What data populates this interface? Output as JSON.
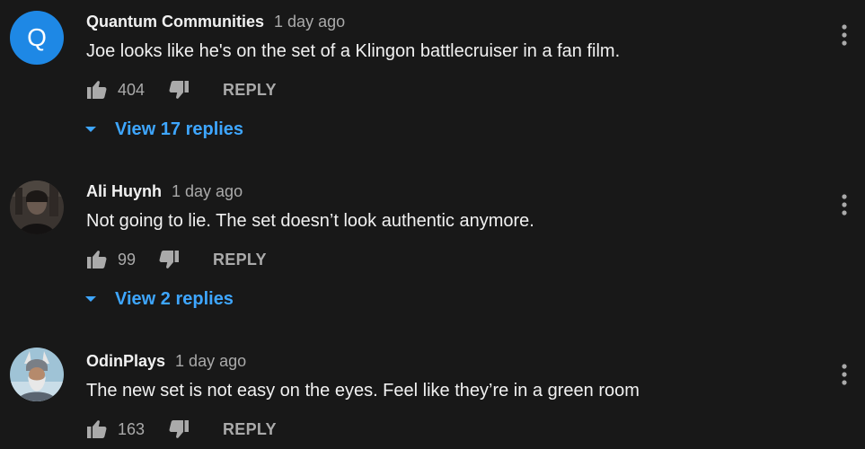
{
  "comments": [
    {
      "author": "Quantum Communities",
      "time": "1 day ago",
      "text": "Joe looks like he's on the set of a Klingon battlecruiser in a fan film.",
      "avatar_letter": "Q",
      "avatar_color": "#1e88e5",
      "likes": "404",
      "reply_label": "REPLY",
      "view_replies": "View 17 replies"
    },
    {
      "author": "Ali Huynh",
      "time": "1 day ago",
      "text": "Not going to lie. The set doesn’t look authentic anymore.",
      "likes": "99",
      "reply_label": "REPLY",
      "view_replies": "View 2 replies"
    },
    {
      "author": "OdinPlays",
      "time": "1 day ago",
      "text": "The new set is not easy on the eyes. Feel like they’re in a green room",
      "likes": "163",
      "reply_label": "REPLY"
    }
  ],
  "icons": {
    "like": "thumbs-up-icon",
    "dislike": "thumbs-down-icon",
    "expand": "chevron-down-icon",
    "menu": "more-vertical-icon"
  },
  "colors": {
    "background": "#181818",
    "text_primary": "#f1f1f1",
    "text_secondary": "#aaaaaa",
    "link": "#3ea6ff"
  }
}
